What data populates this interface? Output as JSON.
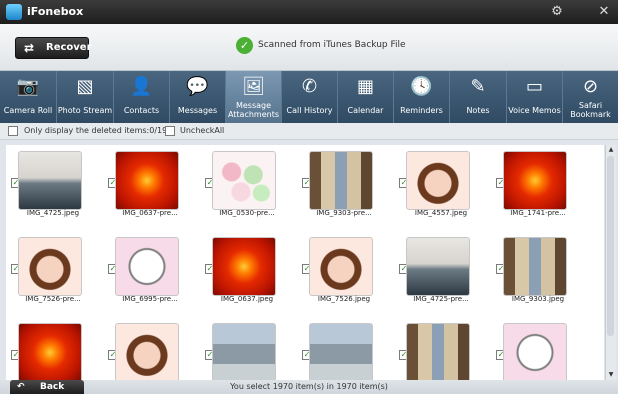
{
  "app": {
    "title": "iFonebox"
  },
  "window": {
    "settings_icon": "gear-icon",
    "close_icon": "close-icon"
  },
  "header": {
    "recover_label": "Recover",
    "recover_icon": "swap-icon",
    "scan_status": "Scanned from iTunes Backup File",
    "scan_icon": "check-circle-icon"
  },
  "toolbar": {
    "items": [
      {
        "label": "Camera Roll",
        "icon": "camera-icon"
      },
      {
        "label": "Photo Stream",
        "icon": "image-icon"
      },
      {
        "label": "Contacts",
        "icon": "person-icon"
      },
      {
        "label": "Messages",
        "icon": "speech-bubble-icon"
      },
      {
        "label": "Message Attachments",
        "icon": "attachment-icon",
        "active": true
      },
      {
        "label": "Call History",
        "icon": "phone-icon"
      },
      {
        "label": "Calendar",
        "icon": "calendar-icon"
      },
      {
        "label": "Reminders",
        "icon": "clock-icon"
      },
      {
        "label": "Notes",
        "icon": "pencil-icon"
      },
      {
        "label": "Voice Memos",
        "icon": "cassette-icon"
      },
      {
        "label": "Safari Bookmark",
        "icon": "compass-icon"
      }
    ]
  },
  "filters": {
    "deleted_only": "Only display the deleted items:0/19",
    "uncheck_all": "UncheckAll"
  },
  "photos": [
    {
      "name": "IMG_4725.jpeg",
      "kind": "sea"
    },
    {
      "name": "IMG_0637-pre...",
      "kind": "flower"
    },
    {
      "name": "IMG_0530-pre...",
      "kind": "macaron"
    },
    {
      "name": "IMG_9303-pre...",
      "kind": "room"
    },
    {
      "name": "IMG_4557.jpeg",
      "kind": "girl"
    },
    {
      "name": "IMG_1741-pre...",
      "kind": "flower"
    },
    {
      "name": "IMG_7526-pre...",
      "kind": "girl"
    },
    {
      "name": "IMG_6995-pre...",
      "kind": "cat"
    },
    {
      "name": "IMG_0637.jpeg",
      "kind": "flower"
    },
    {
      "name": "IMG_7526.jpeg",
      "kind": "girl"
    },
    {
      "name": "IMG_4725-pre...",
      "kind": "sea"
    },
    {
      "name": "IMG_9303.jpeg",
      "kind": "room"
    },
    {
      "name": "",
      "kind": "flower"
    },
    {
      "name": "",
      "kind": "girl"
    },
    {
      "name": "",
      "kind": "building"
    },
    {
      "name": "",
      "kind": "building"
    },
    {
      "name": "",
      "kind": "room"
    },
    {
      "name": "",
      "kind": "cat"
    }
  ],
  "footer": {
    "back_label": "Back",
    "back_icon": "back-arrow-icon",
    "status": "You select 1970 item(s) in 1970 item(s)"
  }
}
